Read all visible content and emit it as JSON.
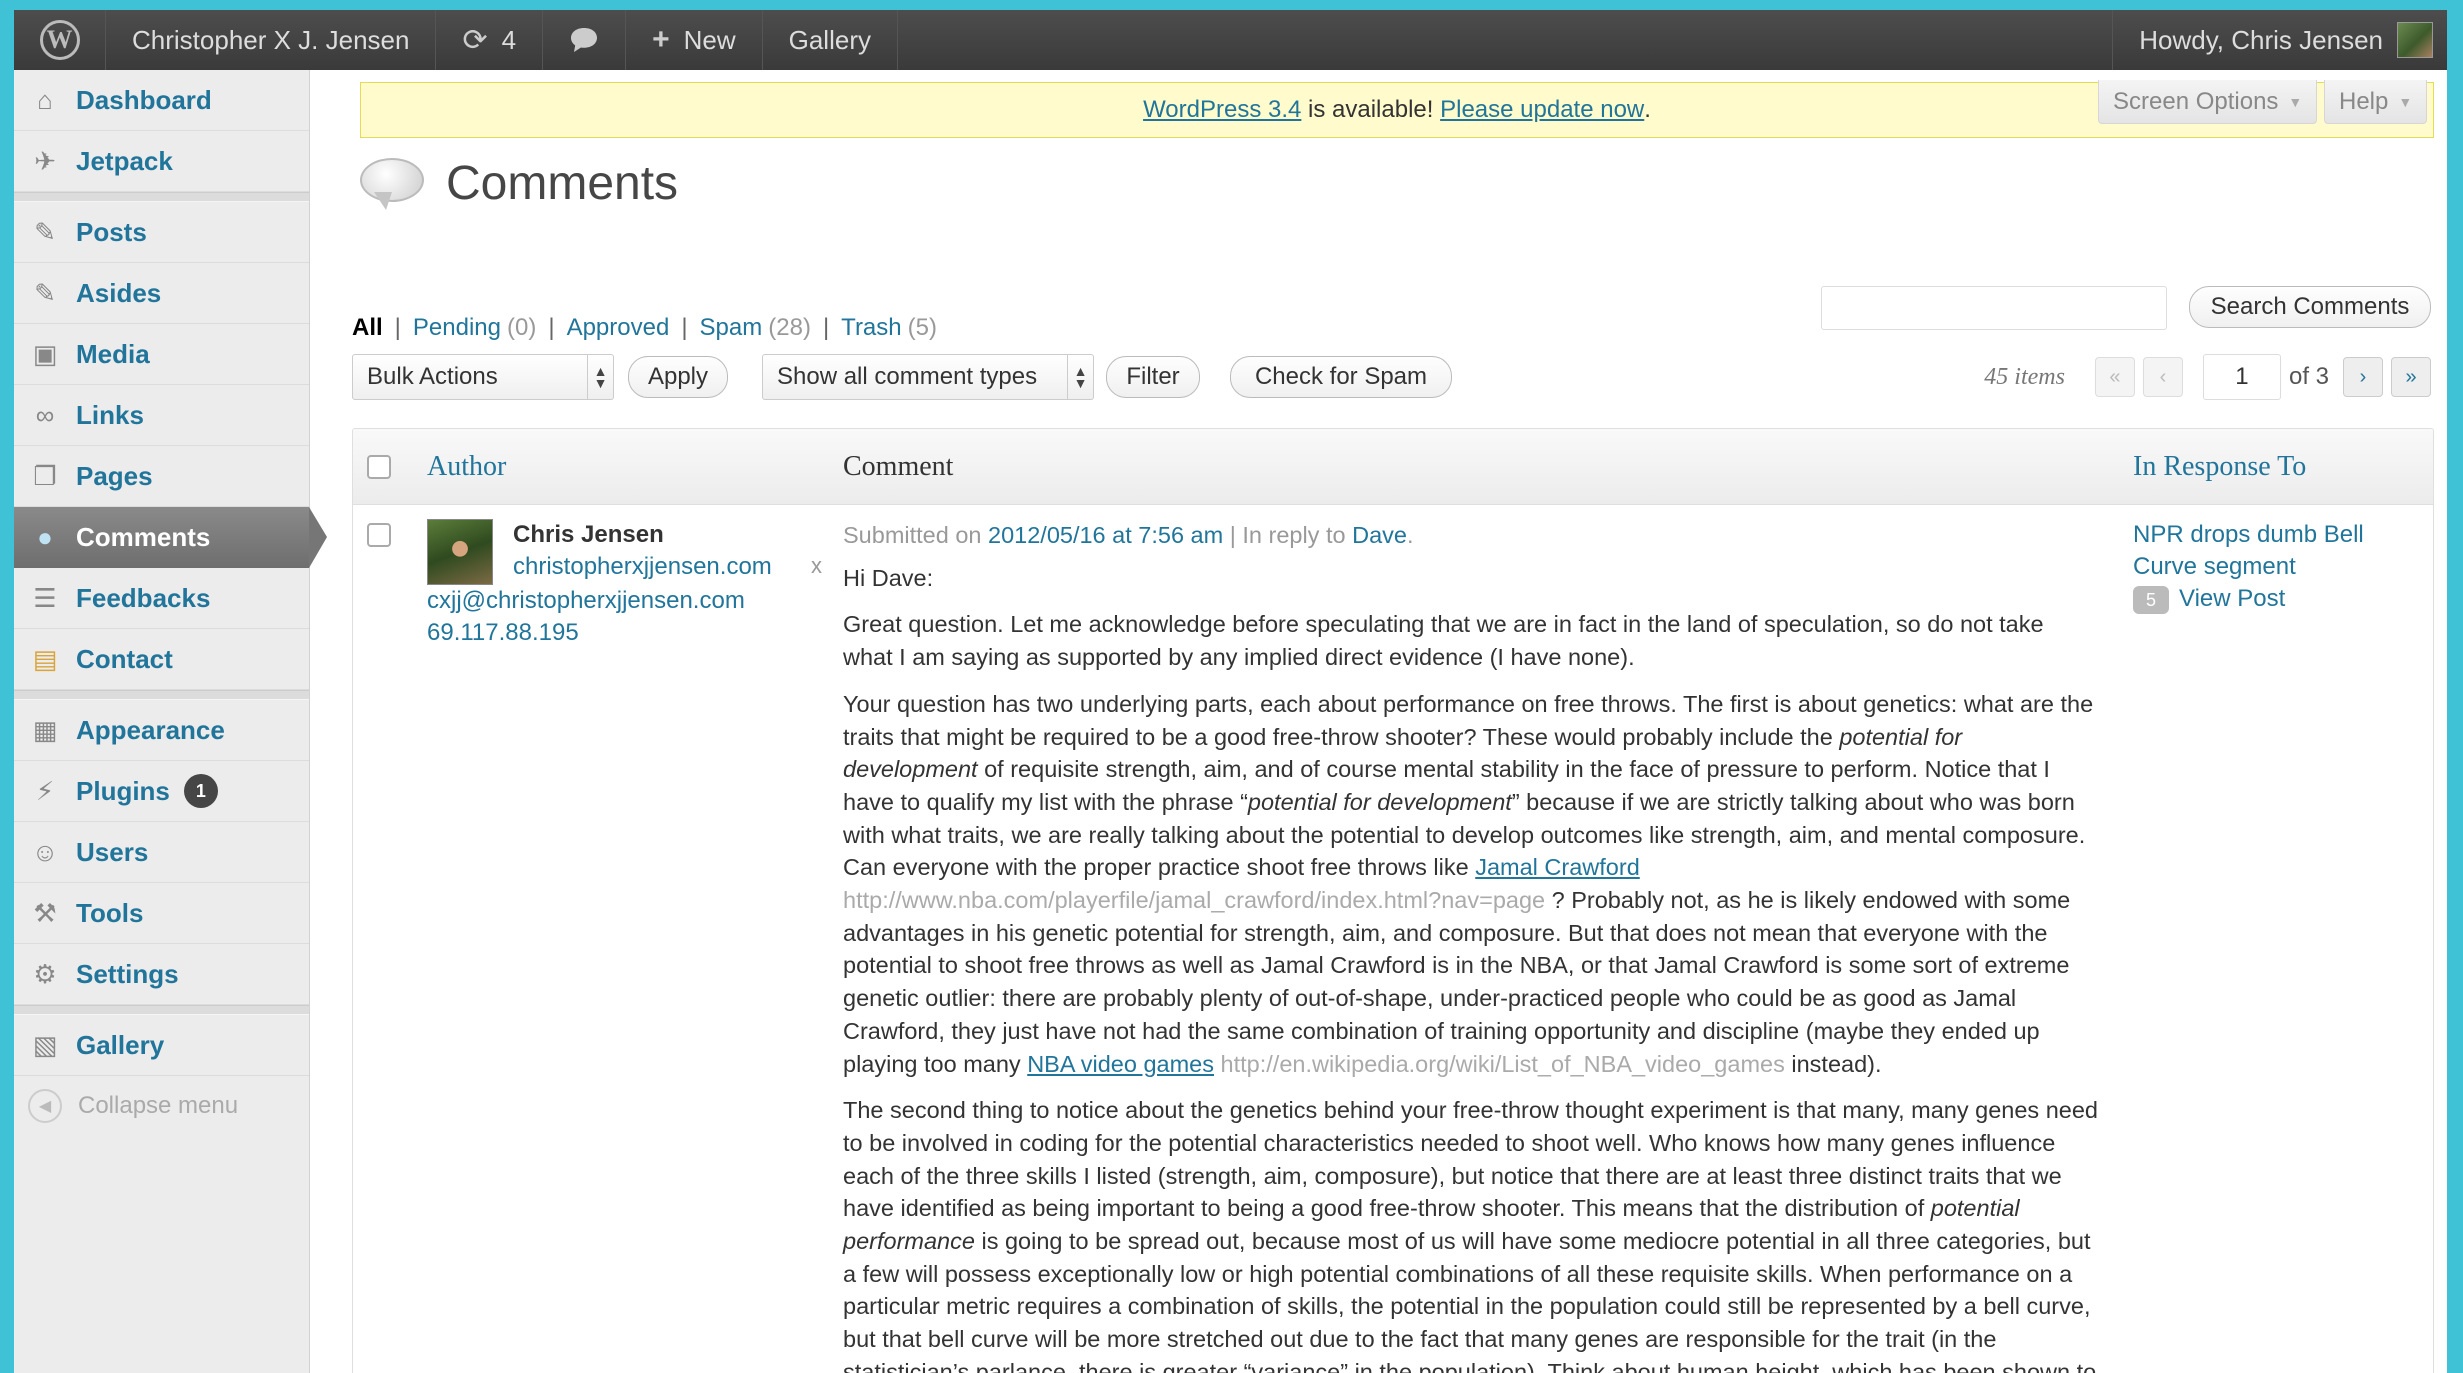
{
  "admin_bar": {
    "site_name": "Christopher X J. Jensen",
    "updates_count": "4",
    "new_label": "New",
    "gallery_label": "Gallery",
    "howdy": "Howdy, Chris Jensen"
  },
  "sidebar": {
    "items": [
      {
        "label": "Dashboard",
        "icon": "dashboard-icon"
      },
      {
        "label": "Jetpack",
        "icon": "jetpack-icon"
      },
      {
        "label": "Posts",
        "icon": "pin-icon"
      },
      {
        "label": "Asides",
        "icon": "pin-icon"
      },
      {
        "label": "Media",
        "icon": "media-icon"
      },
      {
        "label": "Links",
        "icon": "link-icon"
      },
      {
        "label": "Pages",
        "icon": "pages-icon"
      },
      {
        "label": "Comments",
        "icon": "comment-bubble-icon"
      },
      {
        "label": "Feedbacks",
        "icon": "feedback-icon"
      },
      {
        "label": "Contact",
        "icon": "contact-icon"
      },
      {
        "label": "Appearance",
        "icon": "appearance-icon"
      },
      {
        "label": "Plugins",
        "icon": "plugin-icon",
        "badge": "1"
      },
      {
        "label": "Users",
        "icon": "users-icon"
      },
      {
        "label": "Tools",
        "icon": "tools-icon"
      },
      {
        "label": "Settings",
        "icon": "settings-icon"
      },
      {
        "label": "Gallery",
        "icon": "gallery-icon"
      }
    ],
    "collapse_label": "Collapse menu"
  },
  "notice": {
    "version_link": "WordPress 3.4",
    "middle_text": " is available! ",
    "update_link": "Please update now",
    "end_text": "."
  },
  "screen_options_label": "Screen Options",
  "help_label": "Help",
  "page_title": "Comments",
  "filters": {
    "all": "All",
    "pending": "Pending",
    "pending_count": "(0)",
    "approved": "Approved",
    "spam": "Spam",
    "spam_count": "(28)",
    "trash": "Trash",
    "trash_count": "(5)"
  },
  "search_button": "Search Comments",
  "search_value": "",
  "bulk_actions": "Bulk Actions",
  "apply_button": "Apply",
  "comment_type_select": "Show all comment types",
  "filter_button": "Filter",
  "check_spam_button": "Check for Spam",
  "pagination": {
    "items": "45 items",
    "first": "«",
    "prev": "‹",
    "current_page": "1",
    "of_total": "of 3",
    "next": "›",
    "last": "»"
  },
  "table": {
    "col_author": "Author",
    "col_comment": "Comment",
    "col_response": "In Response To"
  },
  "comment": {
    "author_name": "Chris Jensen",
    "author_url": "christopherxjjensen.com",
    "author_x": "x",
    "author_email": "cxjj@christopherxjjensen.com",
    "author_ip": "69.117.88.195",
    "submitted_prefix": "Submitted on ",
    "submitted_date": "2012/05/16 at 7:56 am",
    "reply_prefix": " | In reply to ",
    "reply_to": "Dave",
    "reply_suffix": ".",
    "greeting": "Hi Dave:",
    "para1": "Great question. Let me acknowledge before speculating that we are in fact in the land of speculation, so do not take what I am saying as supported by any implied direct evidence (I have none).",
    "para2_a": "Your question has two underlying parts, each about performance on free throws. The first is about genetics: what are the traits that might be required to be a good free-throw shooter? These would probably include the ",
    "para2_em1": "potential for development",
    "para2_b": " of requisite strength, aim, and of course mental stability in the face of pressure to perform. Notice that I have to qualify my list with the phrase “",
    "para2_em2": "potential for development",
    "para2_c": "” because if we are strictly talking about who was born with what traits, we are really talking about the potential to develop outcomes like strength, aim, and mental composure. Can everyone with the proper practice shoot free throws like ",
    "para2_link1": "Jamal Crawford",
    "para2_url1": "http://www.nba.com/playerfile/jamal_crawford/index.html?nav=page",
    "para2_d": " ? Probably not, as he is likely endowed with some advantages in his genetic potential for strength, aim, and composure. But that does not mean that everyone with the potential to shoot free throws as well as Jamal Crawford is in the NBA, or that Jamal Crawford is some sort of extreme genetic outlier: there are probably plenty of out-of-shape, under-practiced people who could be as good as Jamal Crawford, they just have not had the same combination of training opportunity and discipline (maybe they ended up playing too many ",
    "para2_link2": "NBA video games",
    "para2_url2": "http://en.wikipedia.org/wiki/List_of_NBA_video_games",
    "para2_e": " instead).",
    "para3_a": "The second thing to notice about the genetics behind your free-throw thought experiment is that many, many genes need to be involved in coding for the potential characteristics needed to shoot well. Who knows how many genes influence each of the three skills I listed (strength, aim, composure), but notice that there are at least three distinct traits that we have identified as being important to being a good free-throw shooter. This means that the distribution of ",
    "para3_em": "potential performance",
    "para3_b": " is going to be spread out, because most of us will have some mediocre potential in all three categories, but a few will possess exceptionally low or high potential combinations of all these requisite skills. When performance on a particular metric requires a combination of skills, the potential in the population could still be represented by a bell curve, but that bell curve will be more stretched out due to the fact that many genes are responsible for the trait (in the statistician’s parlance, there is greater “variance” in the population). Think about human height, which has been shown to be influenced by many genes: if there was only",
    "response_title": "NPR drops dumb Bell Curve segment",
    "response_count": "5",
    "view_post": "View Post"
  }
}
